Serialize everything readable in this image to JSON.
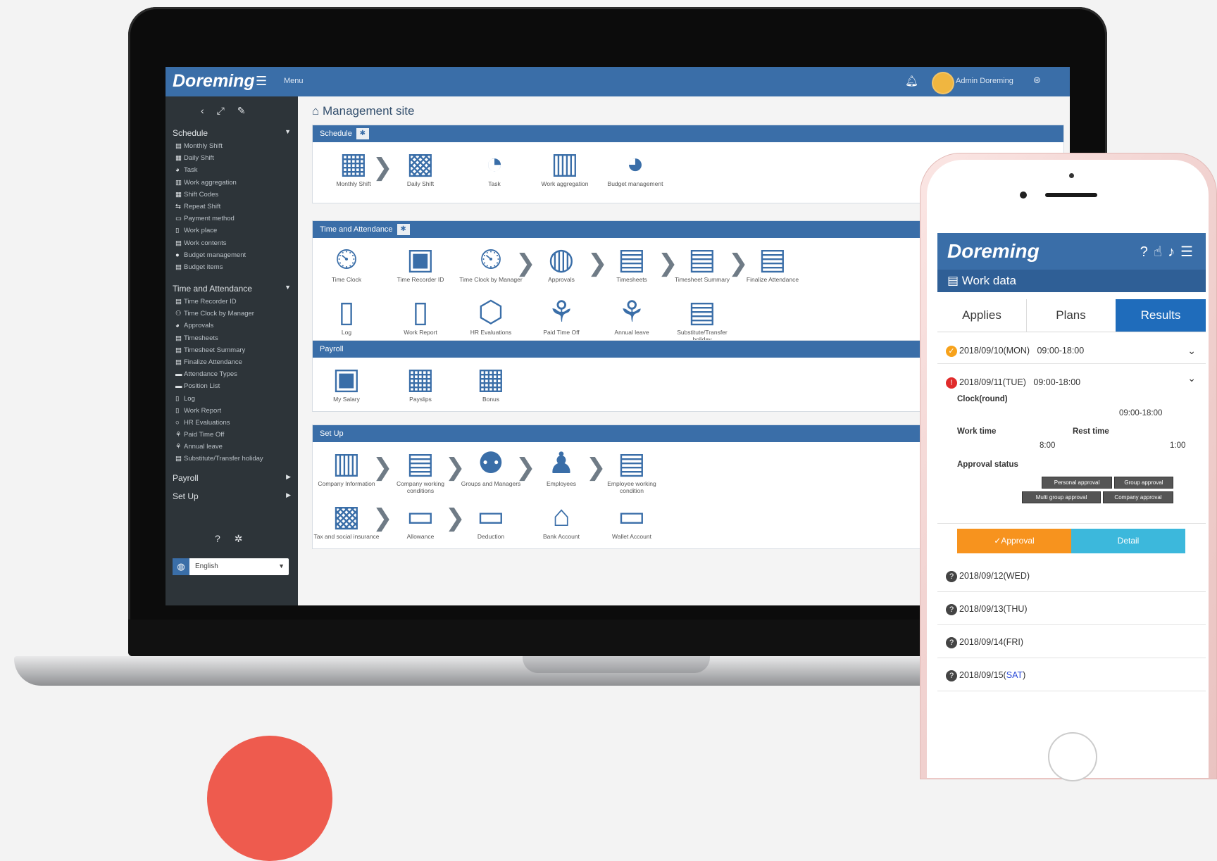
{
  "app": {
    "brand": "Doreming",
    "menu_label": "Menu",
    "admin_name": "Admin Doreming"
  },
  "sidebar": {
    "sections": [
      {
        "title": "Schedule",
        "items": [
          "Monthly Shift",
          "Daily Shift",
          "Task",
          "Work aggregation",
          "Shift Codes",
          "Repeat Shift",
          "Payment method",
          "Work place",
          "Work contents",
          "Budget management",
          "Budget items"
        ]
      },
      {
        "title": "Time and Attendance",
        "items": [
          "Time Recorder ID",
          "Time Clock by Manager",
          "Approvals",
          "Timesheets",
          "Timesheet Summary",
          "Finalize Attendance",
          "Attendance Types",
          "Position List",
          "Log",
          "Work Report",
          "HR Evaluations",
          "Paid Time Off",
          "Annual leave",
          "Substitute/Transfer holiday"
        ]
      },
      {
        "title": "Payroll",
        "items": []
      },
      {
        "title": "Set Up",
        "items": []
      }
    ],
    "language": "English"
  },
  "main": {
    "title": "Management site",
    "panels": {
      "schedule": {
        "title": "Schedule",
        "tiles": [
          "Monthly Shift",
          "Daily Shift",
          "Task",
          "Work aggregation",
          "Budget management"
        ]
      },
      "attendance": {
        "title": "Time and Attendance",
        "row1": [
          "Time Clock",
          "Time Recorder ID",
          "Time Clock by Manager",
          "Approvals",
          "Timesheets",
          "Timesheet Summary",
          "Finalize Attendance"
        ],
        "row2": [
          "Log",
          "Work Report",
          "HR Evaluations",
          "Paid Time Off",
          "Annual leave",
          "Substitute/Transfer holiday"
        ]
      },
      "payroll": {
        "title": "Payroll",
        "tiles": [
          "My Salary",
          "Payslips",
          "Bonus"
        ]
      },
      "setup": {
        "title": "Set Up",
        "row1": [
          "Company Information",
          "Company working conditions",
          "Groups and Managers",
          "Employees",
          "Employee working condition"
        ],
        "row2": [
          "Tax and social insurance",
          "Allowance",
          "Deduction",
          "Bank Account",
          "Wallet Account"
        ]
      }
    }
  },
  "phone": {
    "brand": "Doreming",
    "subtitle": "Work data",
    "tabs": [
      "Applies",
      "Plans",
      "Results"
    ],
    "active_tab": "Results",
    "days": [
      {
        "date": "2018/09/10(MON)",
        "time": "09:00-18:00"
      },
      {
        "date": "2018/09/11(TUE)",
        "time": "09:00-18:00"
      },
      {
        "date": "2018/09/12(WED)"
      },
      {
        "date": "2018/09/13(THU)"
      },
      {
        "date": "2018/09/14(FRI)"
      },
      {
        "date_prefix": "2018/09/15(",
        "date_day": "SAT",
        "date_suffix": ")"
      }
    ],
    "detail": {
      "clock_label": "Clock(round)",
      "clock_value": "09:00-18:00",
      "work_time_label": "Work time",
      "work_time_value": "8:00",
      "rest_time_label": "Rest time",
      "rest_time_value": "1:00",
      "approval_label": "Approval status",
      "badges": [
        "Personal approval",
        "Group approval",
        "Multi group approval",
        "Company approval"
      ],
      "approve_button": "✓Approval",
      "detail_button": "Detail"
    }
  },
  "colors": {
    "brand_blue": "#3a6ea8",
    "sidebar_dark": "#2d3439",
    "approval_orange": "#f7931e",
    "detail_cyan": "#3cb8dc",
    "accent_red": "#ee5b4e"
  }
}
